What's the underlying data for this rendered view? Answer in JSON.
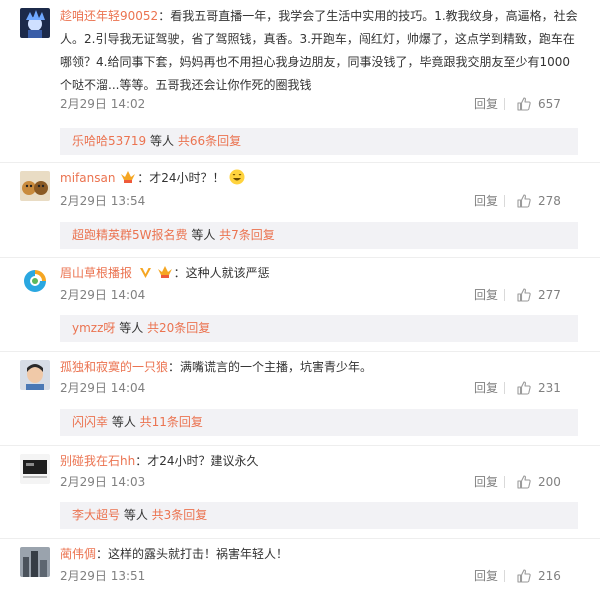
{
  "comments": [
    {
      "name": "趁咱还年轻90052",
      "text": "看我五哥直播一年，我学会了生活中实用的技巧。1.教我纹身，高逼格，社会人。2.引导我无证驾驶，省了驾照钱，真香。3.开跑车，闯红灯，帅爆了，这点学到精致，跑车在哪领？4.给同事下套，妈妈再也不用担心我身边朋友，同事没钱了，毕竟跟我交朋友至少有1000个哒不溜...等等。五哥我还会让你作死的圈我钱",
      "date": "2月29日 14:02",
      "reply": "回复",
      "likes": "657",
      "more_who": "乐哈哈53719",
      "more_mid": " 等人 ",
      "more_count": "共66条回复",
      "avatar": "avatar-blue-spiky"
    },
    {
      "name": "mifansan",
      "text": "：才24小时？！",
      "date": "2月29日 13:54",
      "reply": "回复",
      "likes": "278",
      "more_who": "超跑精英群5W报名费",
      "more_mid": " 等人 ",
      "more_count": "共7条回复",
      "avatar": "avatar-dogs"
    },
    {
      "name": "眉山草根播报",
      "text": "：这种人就该严惩",
      "date": "2月29日 14:04",
      "reply": "回复",
      "likes": "277",
      "more_who": "ymzz呀",
      "more_mid": " 等人 ",
      "more_count": "共20条回复",
      "avatar": "avatar-logo-swirl"
    },
    {
      "name": "孤独和寂寞的一只狼",
      "text": "：满嘴谎言的一个主播，坑害青少年。",
      "date": "2月29日 14:04",
      "reply": "回复",
      "likes": "231",
      "more_who": "闪闪幸",
      "more_mid": " 等人 ",
      "more_count": "共11条回复",
      "avatar": "avatar-child"
    },
    {
      "name": "别碰我在石hh",
      "text": "：才24小时？建议永久",
      "date": "2月29日 14:03",
      "reply": "回复",
      "likes": "200",
      "more_who": "李大超号",
      "more_mid": " 等人 ",
      "more_count": "共3条回复",
      "avatar": "avatar-dark-room"
    },
    {
      "name": "蔺伟倜",
      "text": "：这样的露头就打击！祸害年轻人！",
      "date": "2月29日 13:51",
      "reply": "回复",
      "likes": "216",
      "avatar": "avatar-city-gray"
    }
  ],
  "colors": {
    "name": "#eb7350",
    "meta": "#808080",
    "more_bg": "#f2f2f5"
  }
}
